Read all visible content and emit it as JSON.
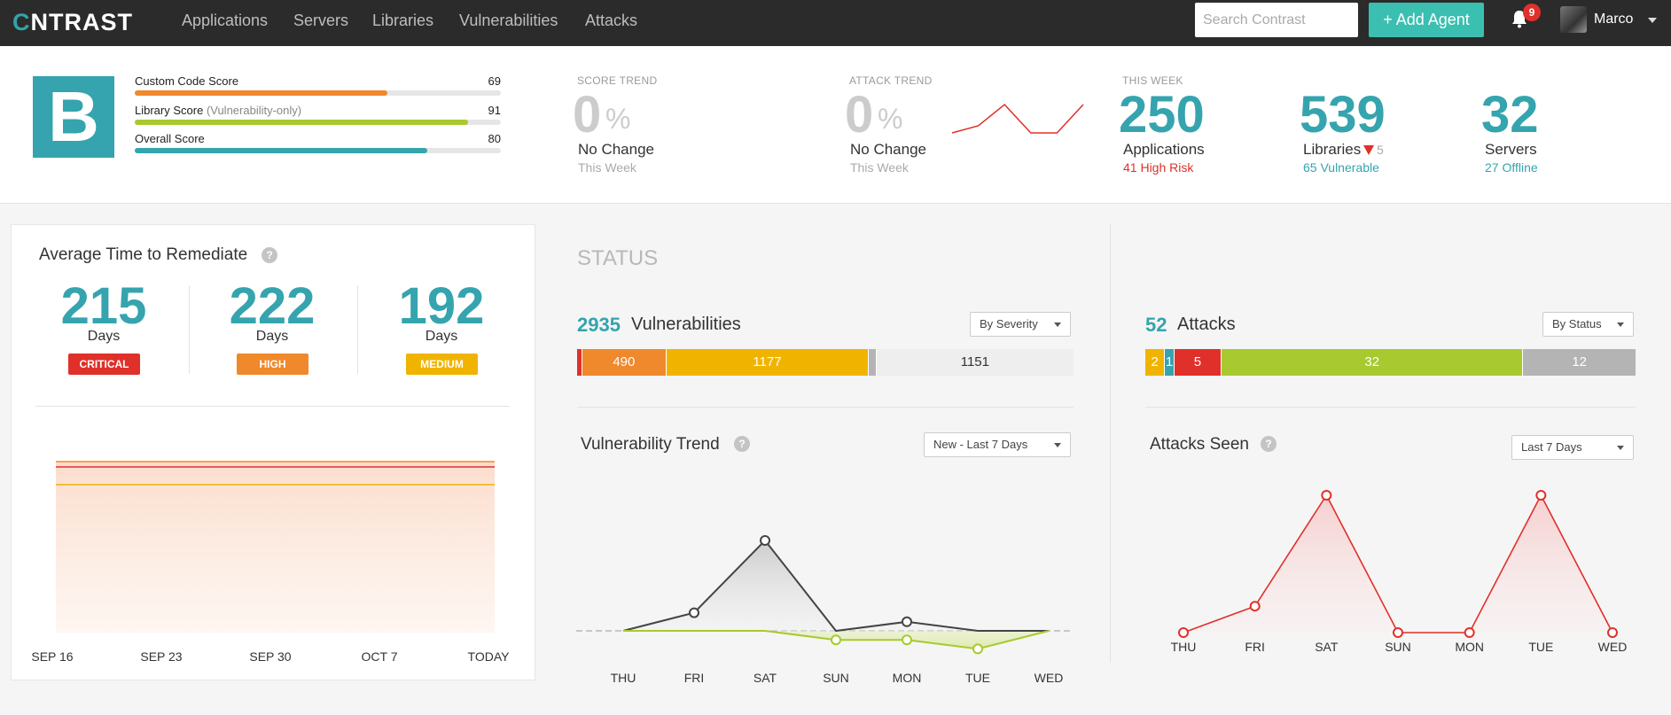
{
  "nav": {
    "logo_c": "C",
    "logo_rest": "NTRAST",
    "links": [
      "Applications",
      "Servers",
      "Libraries",
      "Vulnerabilities",
      "Attacks"
    ],
    "search_placeholder": "Search Contrast",
    "add_agent": "+ Add Agent",
    "notification_count": "9",
    "user": "Marco"
  },
  "scores": {
    "grade": "B",
    "items": [
      {
        "label": "Custom Code Score",
        "label_suffix": "",
        "value": "69",
        "fill": 0.69,
        "color": "#f0882c"
      },
      {
        "label": "Library Score",
        "label_suffix": "(Vulnerability-only)",
        "value": "91",
        "fill": 0.91,
        "color": "#a8c92f"
      },
      {
        "label": "Overall Score",
        "label_suffix": "",
        "value": "80",
        "fill": 0.8,
        "color": "#35a4ae"
      }
    ]
  },
  "score_trend": {
    "heading": "SCORE TREND",
    "value": "0",
    "unit": "%",
    "change": "No Change",
    "period": "This Week"
  },
  "attack_trend": {
    "heading": "ATTACK TREND",
    "value": "0",
    "unit": "%",
    "change": "No Change",
    "period": "This Week"
  },
  "this_week": {
    "heading": "THIS WEEK",
    "applications": {
      "value": "250",
      "label": "Applications",
      "sub": "41 High Risk"
    },
    "libraries": {
      "value": "539",
      "label": "Libraries",
      "delta": "5",
      "sub": "65 Vulnerable"
    },
    "servers": {
      "value": "32",
      "label": "Servers",
      "sub": "27 Offline"
    }
  },
  "remediate": {
    "title": "Average Time to Remediate",
    "help": "?",
    "items": [
      {
        "value": "215",
        "unit": "Days",
        "severity": "CRITICAL",
        "color": "#e0302a"
      },
      {
        "value": "222",
        "unit": "Days",
        "severity": "HIGH",
        "color": "#f0882c"
      },
      {
        "value": "192",
        "unit": "Days",
        "severity": "MEDIUM",
        "color": "#f0b400"
      }
    ],
    "x_labels": [
      "SEP 16",
      "SEP 23",
      "SEP 30",
      "OCT 7",
      "TODAY"
    ]
  },
  "status": {
    "title": "STATUS",
    "vulns": {
      "count": "2935",
      "label": "Vulnerabilities",
      "dropdown": "By Severity",
      "segments": [
        {
          "label": "",
          "value": 25,
          "color": "#e0302a"
        },
        {
          "label": "490",
          "value": 490,
          "color": "#f0882c"
        },
        {
          "label": "1177",
          "value": 1177,
          "color": "#f0b400"
        },
        {
          "label": "",
          "value": 45,
          "color": "#b4b4b4"
        },
        {
          "label": "1151",
          "value": 1151,
          "color": "#eeeeee",
          "text_color": "#333"
        }
      ]
    },
    "attacks": {
      "count": "52",
      "label": "Attacks",
      "dropdown": "By Status",
      "segments": [
        {
          "label": "2",
          "value": 2,
          "color": "#f0b400"
        },
        {
          "label": "1",
          "value": 1,
          "color": "#35a4ae"
        },
        {
          "label": "5",
          "value": 5,
          "color": "#e0302a"
        },
        {
          "label": "32",
          "value": 32,
          "color": "#a8c92f"
        },
        {
          "label": "12",
          "value": 12,
          "color": "#b4b4b4"
        }
      ]
    }
  },
  "vuln_trend": {
    "title": "Vulnerability Trend",
    "help": "?",
    "dropdown": "New - Last 7 Days"
  },
  "attacks_seen": {
    "title": "Attacks Seen",
    "help": "?",
    "dropdown": "Last 7 Days"
  },
  "chart_data": [
    {
      "type": "area",
      "title": "Average Time to Remediate",
      "categories": [
        "SEP 16",
        "SEP 23",
        "SEP 30",
        "OCT 7",
        "TODAY"
      ],
      "series": [
        {
          "name": "CRITICAL",
          "values": [
            215,
            215,
            215,
            215,
            215
          ],
          "color": "#e0302a"
        },
        {
          "name": "HIGH",
          "values": [
            222,
            222,
            222,
            222,
            222
          ],
          "color": "#f0882c"
        },
        {
          "name": "MEDIUM",
          "values": [
            192,
            192,
            192,
            192,
            192
          ],
          "color": "#f0b400"
        }
      ],
      "ylim": [
        0,
        230
      ],
      "grid": false
    },
    {
      "type": "line",
      "title": "Vulnerability Trend",
      "categories": [
        "THU",
        "FRI",
        "SAT",
        "SUN",
        "MON",
        "TUE",
        "WED"
      ],
      "series": [
        {
          "values": [
            0,
            2,
            10,
            0,
            1,
            0,
            0
          ],
          "color": "#444444"
        },
        {
          "values": [
            0,
            0,
            0,
            -1,
            -1,
            -2,
            0
          ],
          "color": "#a8c92f"
        }
      ],
      "ylim": [
        -4,
        12
      ],
      "grid": false
    },
    {
      "type": "line",
      "title": "Attacks Seen",
      "categories": [
        "THU",
        "FRI",
        "SAT",
        "SUN",
        "MON",
        "TUE",
        "WED"
      ],
      "series": [
        {
          "values": [
            0,
            5,
            26,
            0,
            0,
            26,
            0
          ],
          "color": "#e0302a"
        }
      ],
      "ylim": [
        0,
        28
      ],
      "grid": false
    },
    {
      "type": "line",
      "title": "ATTACK TREND",
      "categories": [
        "1",
        "2",
        "3",
        "4",
        "5",
        "6"
      ],
      "series": [
        {
          "values": [
            1,
            2,
            5,
            1,
            1,
            5
          ],
          "color": "#e0302a"
        }
      ],
      "ylim": [
        0,
        6
      ]
    }
  ]
}
